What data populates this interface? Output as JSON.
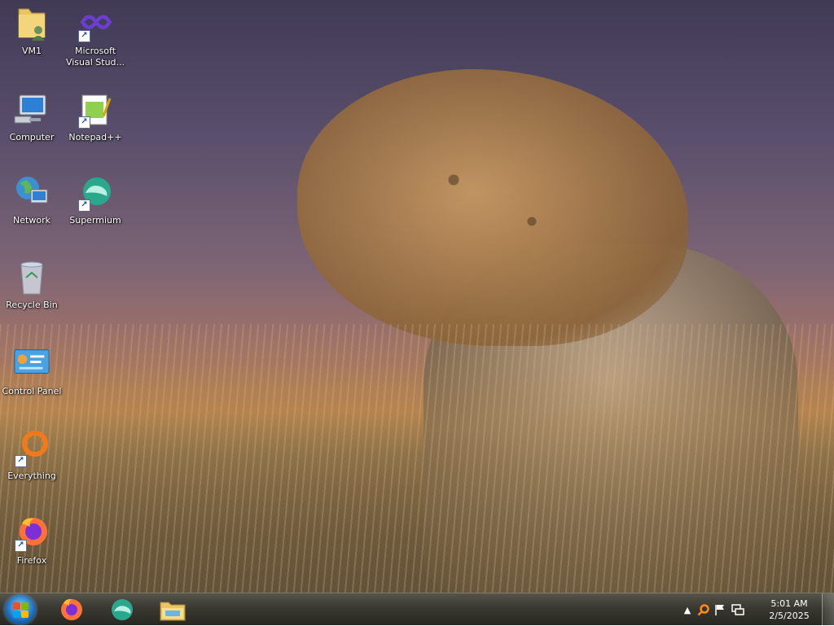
{
  "desktop": {
    "icons": [
      {
        "label": "VM1"
      },
      {
        "label": "Microsoft\nVisual Stud..."
      },
      {
        "label": "Computer"
      },
      {
        "label": "Notepad++"
      },
      {
        "label": "Network"
      },
      {
        "label": "Supermium"
      },
      {
        "label": "Recycle Bin"
      },
      {
        "label": "Control Panel"
      },
      {
        "label": "Everything"
      },
      {
        "label": "Firefox"
      }
    ]
  },
  "taskbar": {
    "pinned": [
      "firefox-icon",
      "supermium-icon",
      "file-explorer-icon"
    ],
    "tray": {
      "time": "5:01 AM",
      "date": "2/5/2025"
    }
  }
}
